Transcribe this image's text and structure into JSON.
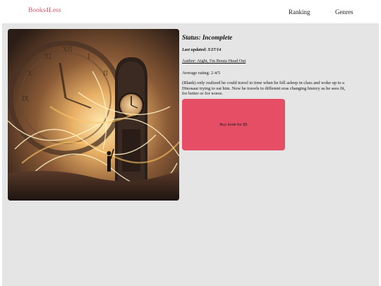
{
  "header": {
    "brand": "Books4Less",
    "nav": [
      {
        "label": "Ranking"
      },
      {
        "label": "Genres"
      }
    ]
  },
  "book": {
    "cover_alt": "Fantasy clock tower cover art",
    "status_label": "Status:",
    "status_value": "Incomplete",
    "last_updated": "Last updated: 3/27/14",
    "author": "Author: Aight, I'm Bouta Head Out",
    "rating": "Average rating: 2.4/5",
    "synopsis": "(Blank) only realized he could travel to time when he fell asleep in class and woke up to a Dinosaur trying to eat him. Now he travels to different eras changing history as he sees fit, for better or for worse.",
    "buy_label": "Buy book for $5"
  },
  "colors": {
    "brand": "#e0506a",
    "buy_button": "#e54e64",
    "panel": "#e5e5e5"
  }
}
